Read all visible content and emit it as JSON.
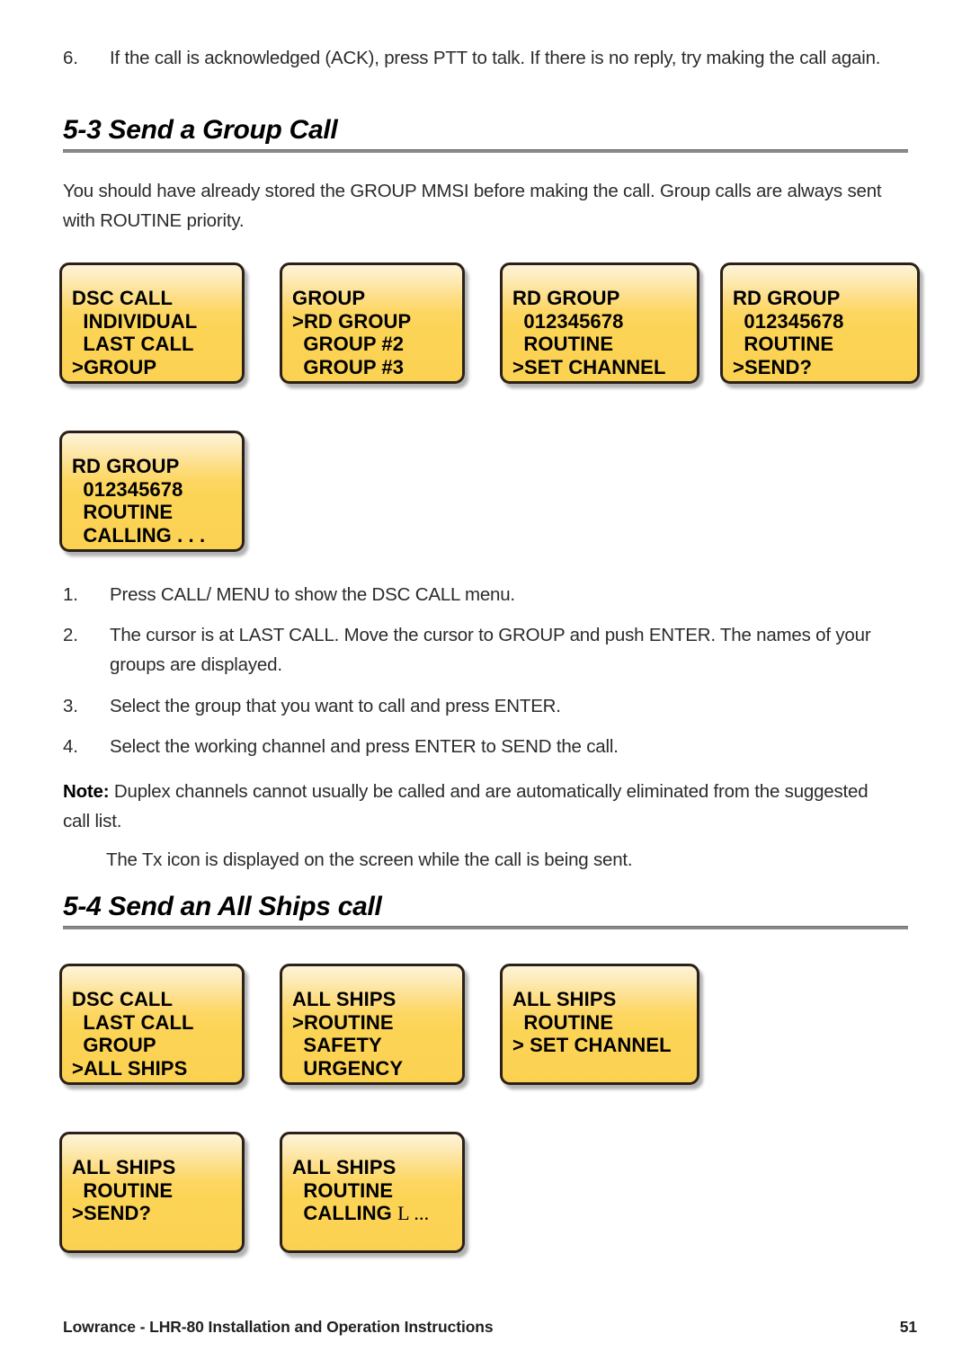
{
  "document": {
    "footer_text": "Lowrance - LHR-80 Installation and Operation Instructions",
    "page_number": "51"
  },
  "top_item": {
    "number": "6.",
    "text": "If the call is acknowledged (ACK), press PTT to talk. If there is no reply, try making the call again."
  },
  "section_group": {
    "heading": "5-3 Send a Group Call",
    "intro": "You should have already stored the GROUP MMSI before making the call. Group calls are always sent with ROUTINE priority.",
    "screens": [
      {
        "name": "dsc-call-menu",
        "lines": [
          "DSC CALL",
          "  INDIVIDUAL",
          "  LAST CALL",
          ">GROUP"
        ]
      },
      {
        "name": "group-list",
        "lines": [
          "GROUP",
          ">RD GROUP",
          "  GROUP #2",
          "  GROUP #3"
        ]
      },
      {
        "name": "rd-group-set-channel",
        "lines": [
          "RD GROUP",
          "  012345678",
          "  ROUTINE",
          ">SET CHANNEL"
        ]
      },
      {
        "name": "rd-group-send",
        "lines": [
          "RD GROUP",
          "  012345678",
          "  ROUTINE",
          ">SEND?"
        ]
      },
      {
        "name": "rd-group-calling",
        "lines": [
          "RD GROUP",
          "  012345678",
          "  ROUTINE",
          "  CALLING . . ."
        ]
      }
    ],
    "steps": [
      {
        "number": "1.",
        "text": "Press CALL/ MENU to show the DSC CALL menu."
      },
      {
        "number": "2.",
        "text": "The cursor is at LAST CALL. Move the cursor to GROUP and push ENTER. The names of your groups are displayed."
      },
      {
        "number": "3.",
        "text": "Select the group that you want to call and press ENTER."
      },
      {
        "number": "4.",
        "text": "Select the working channel and press ENTER to SEND the call."
      }
    ],
    "note_label": "Note:",
    "note_text": " Duplex channels cannot usually be called and are automatically eliminated from the suggested call list.",
    "note_followup": "The Tx icon is displayed on the screen while the call is being sent."
  },
  "section_all_ships": {
    "heading": "5-4 Send an All Ships call",
    "screens": [
      {
        "name": "dsc-call-menu-all-ships",
        "lines": [
          "DSC CALL",
          "  LAST CALL",
          "  GROUP",
          ">ALL SHIPS"
        ]
      },
      {
        "name": "all-ships-priority",
        "lines": [
          "ALL SHIPS",
          ">ROUTINE",
          "  SAFETY",
          "  URGENCY"
        ]
      },
      {
        "name": "all-ships-set-channel",
        "lines": [
          "ALL SHIPS",
          "  ROUTINE",
          "> SET CHANNEL"
        ]
      },
      {
        "name": "all-ships-send",
        "lines": [
          "ALL SHIPS",
          "  ROUTINE",
          ">SEND?"
        ]
      },
      {
        "name": "all-ships-calling",
        "lines": [
          "ALL SHIPS",
          "  ROUTINE",
          "  CALLING ",
          "L ..."
        ]
      }
    ]
  },
  "colors": {
    "lcd_top": "#fdf4d8",
    "lcd_bottom": "#fbd152",
    "lcd_border": "#2b2118",
    "rule": "#888a8c",
    "text": "#2b2b2b"
  }
}
